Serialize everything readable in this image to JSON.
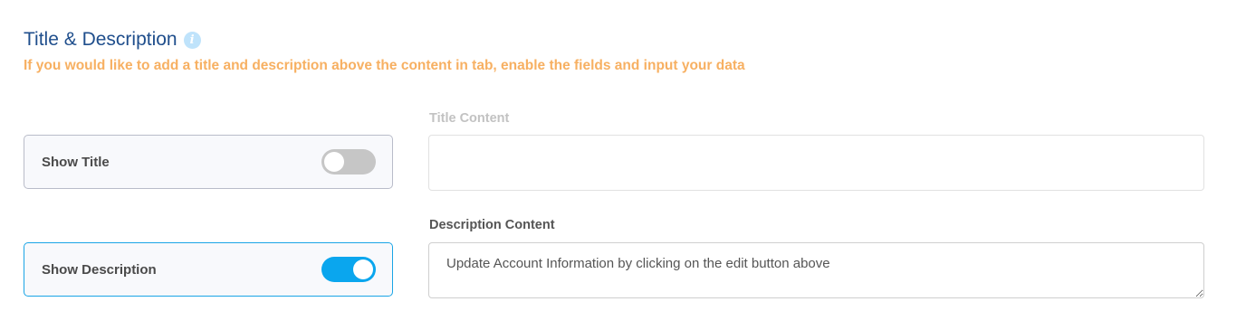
{
  "section": {
    "title": "Title & Description",
    "subtitle": "If you would like to add a title and description above the content in tab, enable the fields and input your data",
    "info_icon": "info-icon"
  },
  "toggles": [
    {
      "label": "Show Title",
      "enabled": false
    },
    {
      "label": "Show Description",
      "enabled": true
    }
  ],
  "fields": {
    "title_content": {
      "label": "Title Content",
      "value": "",
      "disabled": true
    },
    "description_content": {
      "label": "Description Content",
      "value": "Update Account Information by clicking on the edit button above",
      "disabled": false
    }
  },
  "colors": {
    "title": "#1f4e8c",
    "subtitle": "#f7b062",
    "switch_on": "#0aa6ee",
    "switch_off": "#c6c6c6",
    "active_border": "#1aa5e6"
  }
}
